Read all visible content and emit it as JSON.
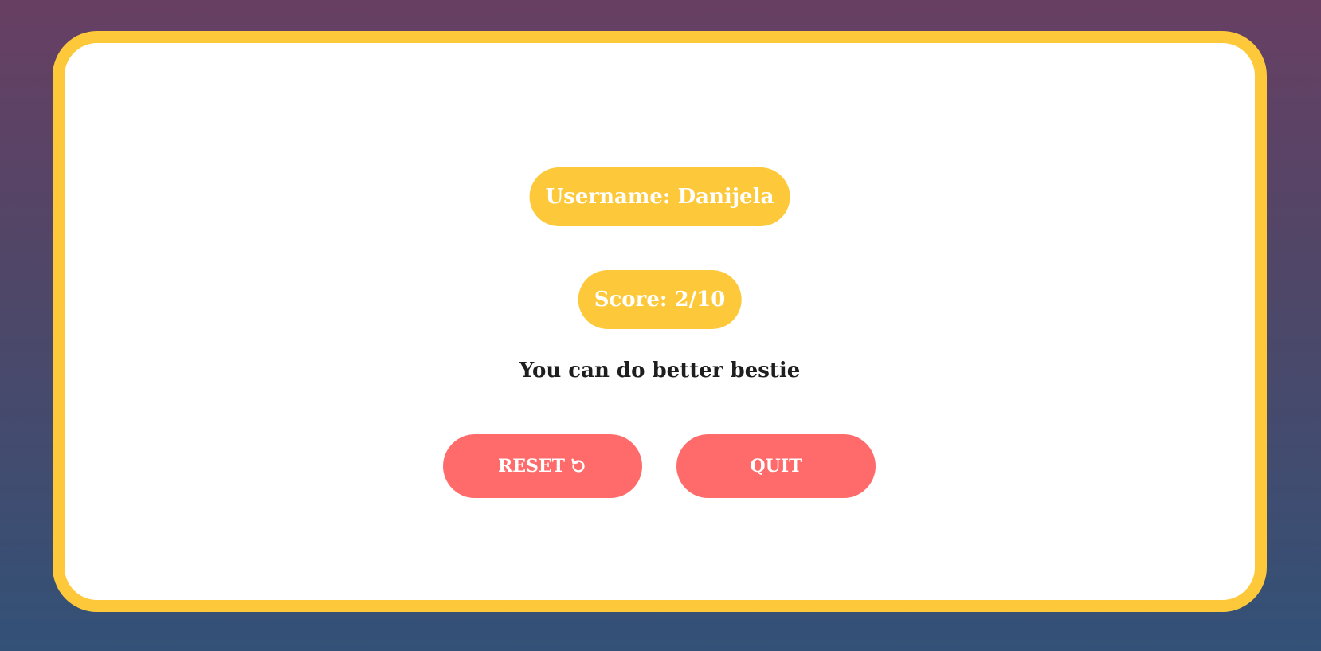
{
  "result": {
    "username_label": "Username: Danijela",
    "score_label": "Score: 2/10",
    "message": "You can do better bestie"
  },
  "actions": {
    "reset_label": "RESET",
    "reset_icon": "reset-icon",
    "quit_label": "QUIT"
  },
  "colors": {
    "accent": "#fdc93a",
    "button": "#ff6b6b",
    "background_top": "#673f63",
    "background_bottom": "#335177"
  }
}
